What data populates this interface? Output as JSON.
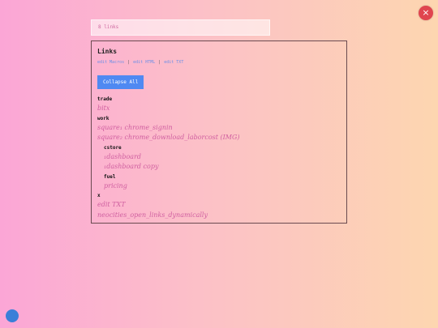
{
  "close": {
    "icon": "×",
    "icon_name": "close-icon"
  },
  "search": {
    "text": "8 links"
  },
  "panel": {
    "title": "Links",
    "edit_links": [
      "edit Macros",
      "edit HTML",
      "edit TXT"
    ],
    "separator": "|",
    "collapse_label": "Collapse All"
  },
  "tree": {
    "trade_folder": "trade",
    "trade_link_1": "bitx",
    "work_folder": "work",
    "work_link_1": "square₁ chrome_signin",
    "work_link_2": "square₂ chrome_download_laborcost (IMG)",
    "cstore_folder": "cstore",
    "cstore_link_1": "₁dashboard",
    "cstore_link_2": "₁dashboard copy",
    "fuel_folder": "fuel",
    "fuel_link_1": "pricing",
    "x_folder": "x",
    "x_link_1": "edit TXT",
    "x_link_2": "neocities_open_links_dynamically"
  },
  "colors": {
    "close": "#e0454f",
    "accent_button": "#4f89f2",
    "link": "#d05fa0",
    "edit_link": "#6b8fe8",
    "dot": "#3a7fd8"
  }
}
